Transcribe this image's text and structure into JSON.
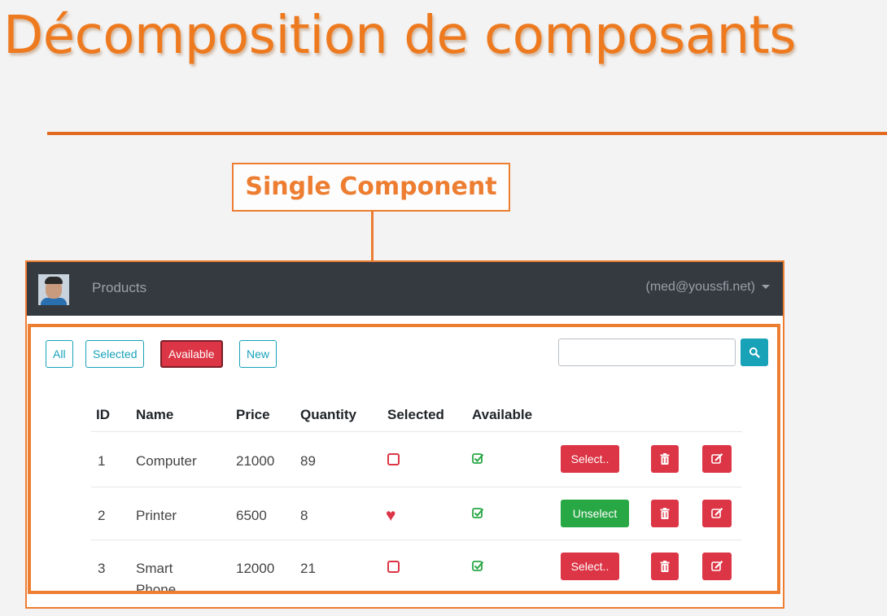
{
  "slide": {
    "title": "Décomposition de composants",
    "callout": "Single Component"
  },
  "navbar": {
    "brand": "Products",
    "user": "(med@youssfi.net)"
  },
  "filters": {
    "all": "All",
    "selected": "Selected",
    "available": "Available",
    "new": "New",
    "active": "Available"
  },
  "search": {
    "value": "",
    "button_icon": "search-icon"
  },
  "table": {
    "headers": [
      "ID",
      "Name",
      "Price",
      "Quantity",
      "Selected",
      "Available"
    ],
    "rows": [
      {
        "id": "1",
        "name": "Computer",
        "price": "21000",
        "quantity": "89",
        "selected": false,
        "available": true,
        "action_label": "Select.."
      },
      {
        "id": "2",
        "name": "Printer",
        "price": "6500",
        "quantity": "8",
        "selected": true,
        "available": true,
        "action_label": "Unselect"
      },
      {
        "id": "3",
        "name": "Smart Phone",
        "name_line1": "Smart",
        "name_line2": "Phone",
        "price": "12000",
        "quantity": "21",
        "selected": false,
        "available": true,
        "action_label": "Select.."
      }
    ]
  },
  "colors": {
    "accent_orange": "#ed7d31",
    "navbar_dark": "#343a40",
    "danger_red": "#dc3545",
    "success_green": "#28a745",
    "info_teal": "#17a2b8"
  },
  "icons": {
    "selected_true": "heart-icon",
    "selected_false": "empty-square-icon",
    "available_true": "check-square-icon",
    "delete": "trash-icon",
    "edit": "edit-icon"
  }
}
